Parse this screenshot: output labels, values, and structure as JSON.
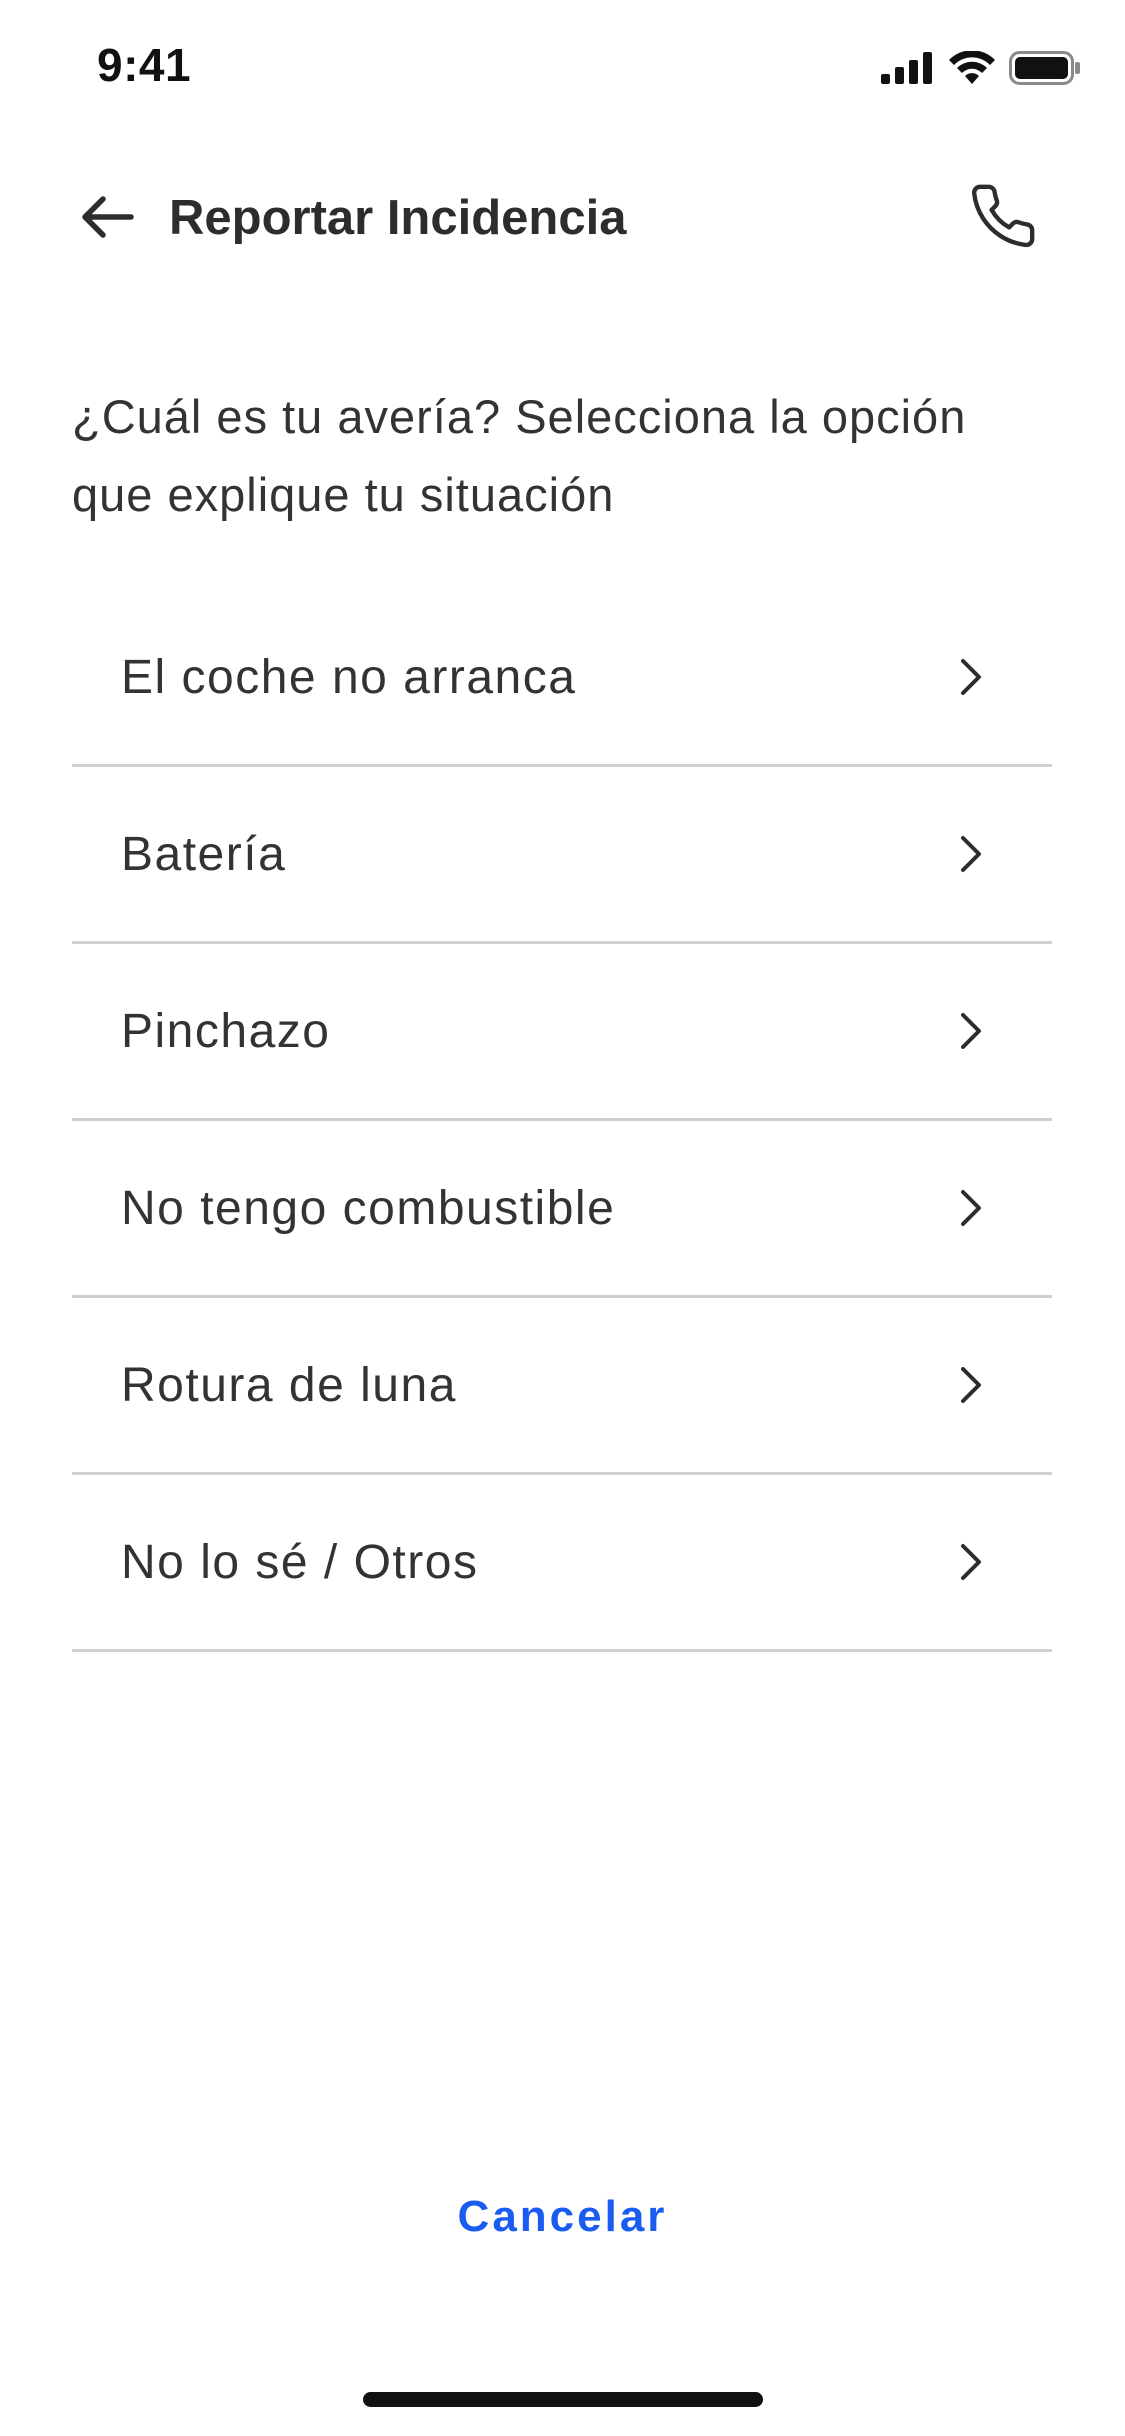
{
  "status_bar": {
    "time": "9:41",
    "icons": [
      "cellular-signal-icon",
      "wifi-icon",
      "battery-icon"
    ]
  },
  "header": {
    "title": "Reportar Incidencia",
    "back_icon": "arrow-left-icon",
    "call_icon": "phone-icon"
  },
  "question": "¿Cuál es tu avería? Selecciona la opción que explique tu situación",
  "options": [
    {
      "label": "El coche no arranca"
    },
    {
      "label": "Batería"
    },
    {
      "label": "Pinchazo"
    },
    {
      "label": "No tengo combustible"
    },
    {
      "label": "Rotura de luna"
    },
    {
      "label": "No lo sé / Otros"
    }
  ],
  "cancel_label": "Cancelar",
  "colors": {
    "accent": "#1a5cf0",
    "text": "#333333",
    "divider": "#cfcfcf"
  }
}
